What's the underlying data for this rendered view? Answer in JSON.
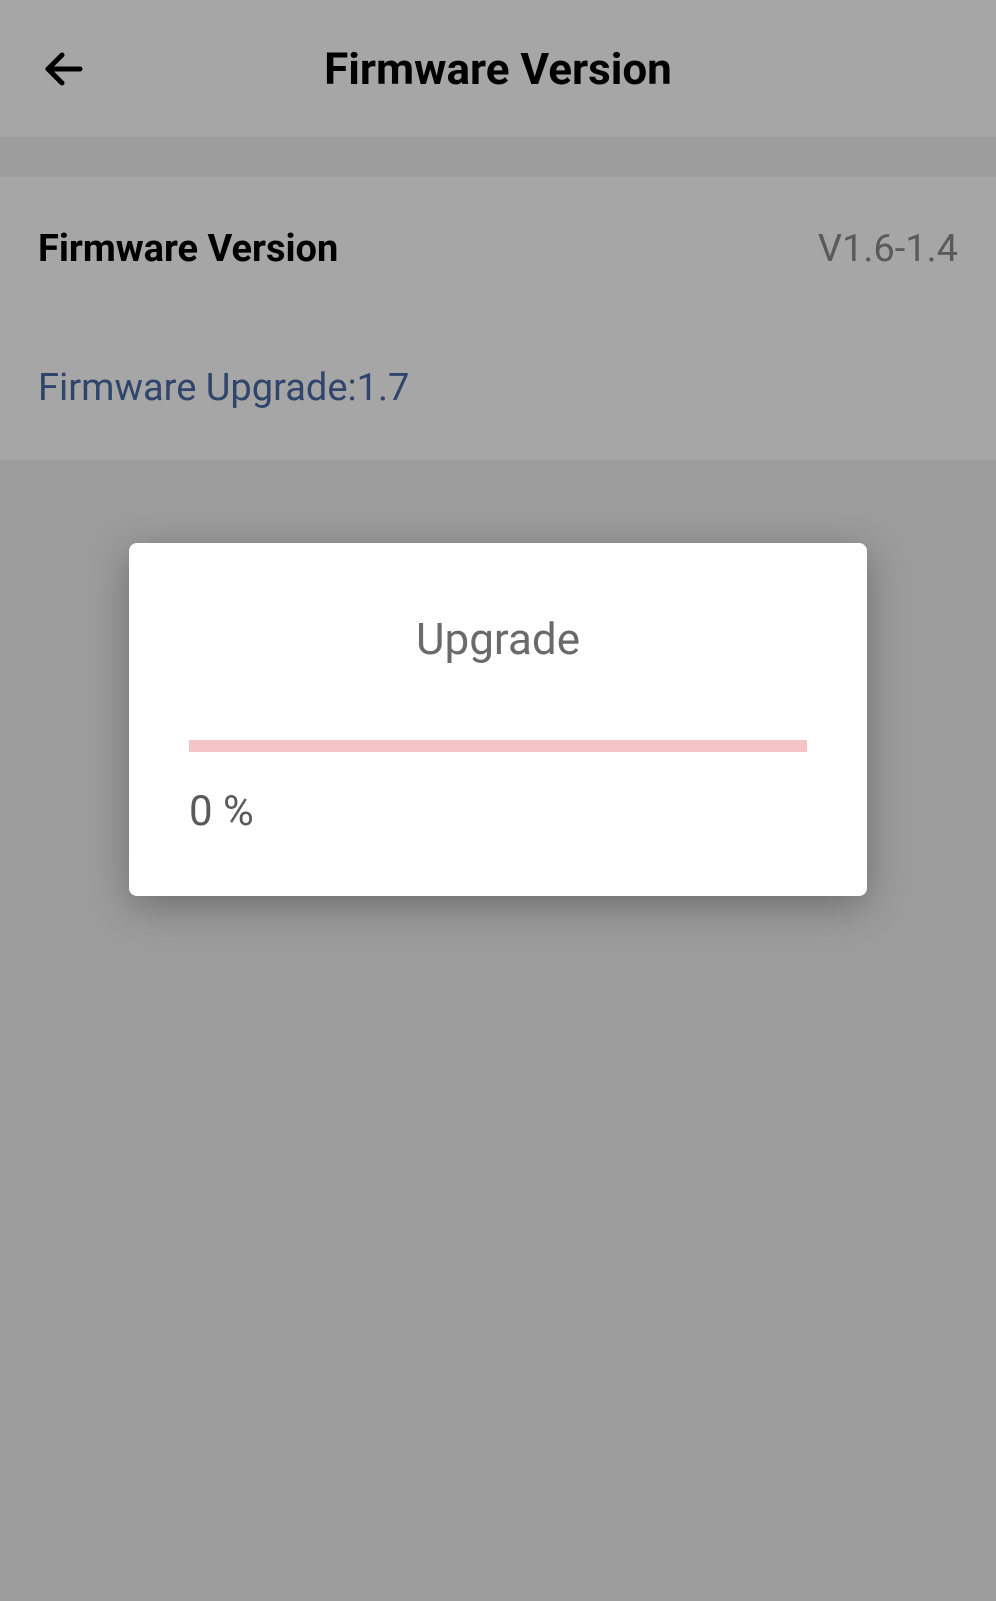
{
  "header": {
    "title": "Firmware Version"
  },
  "content": {
    "version_label": "Firmware Version",
    "version_value": "V1.6-1.4",
    "upgrade_link": "Firmware Upgrade:1.7"
  },
  "modal": {
    "title": "Upgrade",
    "progress_text": "0 %"
  }
}
